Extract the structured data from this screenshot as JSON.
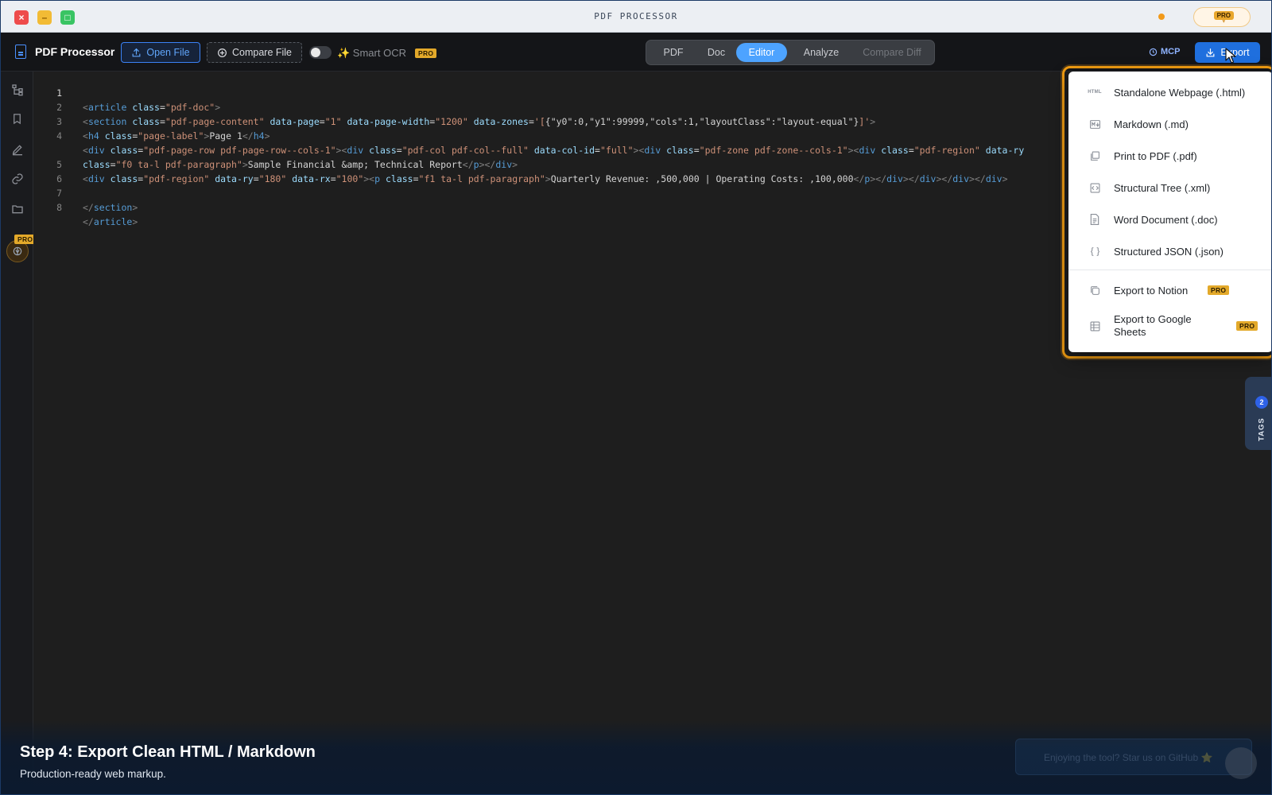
{
  "window": {
    "title": "PDF PROCESSOR"
  },
  "titlebar": {
    "close_glyph": "×",
    "min_glyph": "–",
    "max_glyph": "□",
    "send_icon": "send-icon",
    "send_badge": "PRO"
  },
  "toolbar": {
    "app_name": "PDF Processor",
    "open_file": "Open File",
    "compare_file": "Compare File",
    "smart_ocr": "✨ Smart OCR",
    "smart_ocr_badge": "PRO",
    "modes": [
      "PDF",
      "Doc",
      "Editor",
      "Analyze",
      "Compare Diff"
    ],
    "active_mode": "Editor",
    "mcp": "MCP",
    "export": "Export"
  },
  "rail": {
    "icons": [
      "tree-icon",
      "bookmark-icon",
      "edit-icon",
      "link-icon",
      "folder-icon",
      "brain-icon"
    ],
    "pro_badge": "PRO"
  },
  "editor": {
    "active_line": 1,
    "line_numbers": [
      "1",
      "2",
      "3",
      "4",
      "",
      "5",
      "6",
      "7",
      "8"
    ]
  },
  "export_menu": {
    "items": [
      {
        "icon": "HTML",
        "label": "Standalone Webpage (.html)"
      },
      {
        "icon": "md",
        "label": "Markdown (.md)"
      },
      {
        "icon": "pdf",
        "label": "Print to PDF (.pdf)"
      },
      {
        "icon": "code",
        "label": "Structural Tree (.xml)"
      },
      {
        "icon": "doc",
        "label": "Word Document (.doc)"
      },
      {
        "icon": "braces",
        "label": "Structured JSON (.json)"
      }
    ],
    "pro_items": [
      {
        "icon": "notion",
        "label": "Export to Notion",
        "badge": "PRO"
      },
      {
        "icon": "sheets",
        "label": "Export to Google Sheets",
        "badge": "PRO"
      }
    ]
  },
  "tags": {
    "count": "2",
    "label": "TAGS"
  },
  "caption": {
    "title": "Step 4: Export Clean HTML / Markdown",
    "subtitle": "Production-ready web markup."
  },
  "toast": {
    "text": "Enjoying the tool? Star us on GitHub ⭐"
  },
  "colors": {
    "accent": "#4da3ff",
    "export_button": "#1f6fde",
    "highlight": "#f29d12",
    "pro": "#e3a92a"
  }
}
